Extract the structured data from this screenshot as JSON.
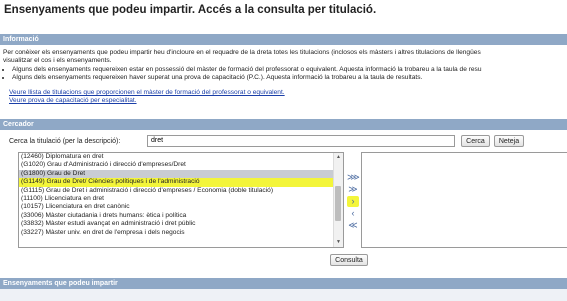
{
  "page_title": "Ensenyaments que podeu impartir. Accés a la consulta per titulació.",
  "info": {
    "header": "Informació",
    "intro_line1": "Per conèixer els ensenyaments que podeu impartir heu d'incloure en el requadre de la dreta totes les titulacions (inclosos els màsters i altres titulacions de llengües",
    "intro_line2": "visualitzar el cos i els ensenyaments.",
    "bullet1": "Alguns dels ensenyaments requereixen estar en possessió del màster de formació del professorat o equivalent. Aquesta informació la trobareu a la taula de resu",
    "bullet2": "Alguns dels ensenyaments requereixen haver superat una prova de capacitació (P.C.). Aquesta informació la trobareu a la taula de resultats.",
    "link1": "Veure llista de titulacions que proporcionen el màster de formació del professorat o equivalent.",
    "link2": "Veure prova de capacitació per especialitat."
  },
  "search": {
    "header": "Cercador",
    "label": "Cerca la titulació (per la descripció):",
    "value": "dret",
    "search_button": "Cerca",
    "clear_button": "Neteja",
    "consult_button": "Consulta"
  },
  "results": [
    {
      "text": "(12460) Diplomatura en dret",
      "state": "normal"
    },
    {
      "text": "(G1020) Grau d'Administració i direcció d'empreses/Dret",
      "state": "normal"
    },
    {
      "text": "(G1800) Grau de Dret",
      "state": "selected"
    },
    {
      "text": "(G1149) Grau de Dret/ Ciències polítiques i de l'administració",
      "state": "highlight"
    },
    {
      "text": "(G1115) Grau de Dret i administració i direcció d'empreses / Economia (doble titulació)",
      "state": "normal"
    },
    {
      "text": "(11100) Llicenciatura en dret",
      "state": "normal"
    },
    {
      "text": "(10157) Llicenciatura en dret canònic",
      "state": "normal"
    },
    {
      "text": "(33006) Màster ciutadania i drets humans: ètica i política",
      "state": "normal"
    },
    {
      "text": "(33832) Màster estudi avançat en administració i dret públic",
      "state": "normal"
    },
    {
      "text": "(33227) Màster univ. en dret de l'empresa i dels negocis",
      "state": "normal"
    }
  ],
  "transfer_buttons": [
    {
      "symbol": "⋙",
      "name": "add-all-button"
    },
    {
      "symbol": "≫",
      "name": "add-all-alt-button"
    },
    {
      "symbol": "›",
      "name": "add-selected-button"
    },
    {
      "symbol": "‹",
      "name": "remove-selected-button"
    },
    {
      "symbol": "≪",
      "name": "remove-all-button"
    }
  ],
  "bottom_header": "Ensenyaments que podeu impartir",
  "colors": {
    "header_bg": "#8fa8c6",
    "highlight": "#f3f53a",
    "selected": "#c9ccd3",
    "link": "#1a3ea8"
  }
}
